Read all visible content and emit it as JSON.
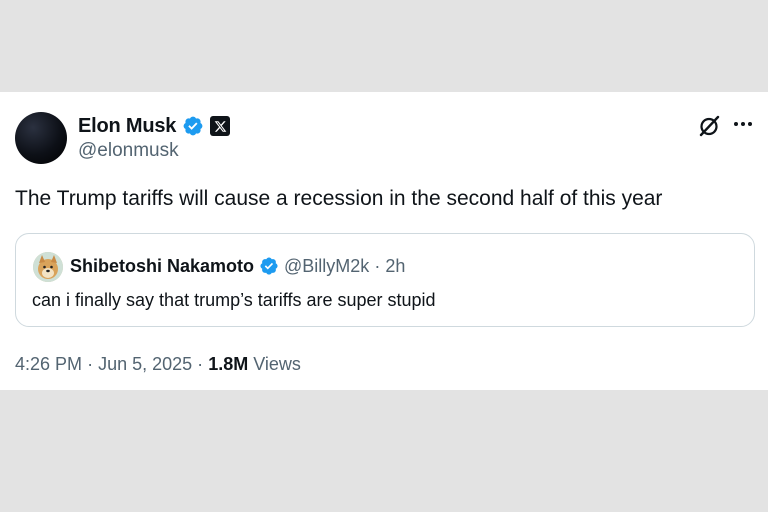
{
  "author": {
    "name": "Elon Musk",
    "handle": "@elonmusk"
  },
  "tweet": {
    "text": "The Trump tariffs will cause a recession in the second half of this year"
  },
  "quoted": {
    "name": "Shibetoshi Nakamoto",
    "handle": "@BillyM2k",
    "time_sep": "·",
    "time": "2h",
    "text": "can i finally say that trump’s tariffs are super stupid"
  },
  "meta": {
    "time": "4:26 PM",
    "sep1": "·",
    "date": "Jun 5, 2025",
    "sep2": "·",
    "views_count": "1.8M",
    "views_label": "Views"
  },
  "icons": {
    "verified": "verified-badge-icon",
    "affiliate": "x-logo-icon",
    "grok": "grok-icon",
    "more": "more-icon"
  },
  "colors": {
    "verified_blue": "#1d9bf0",
    "muted_text": "#536471",
    "primary_text": "#0f1419",
    "border": "#cfd9de"
  }
}
